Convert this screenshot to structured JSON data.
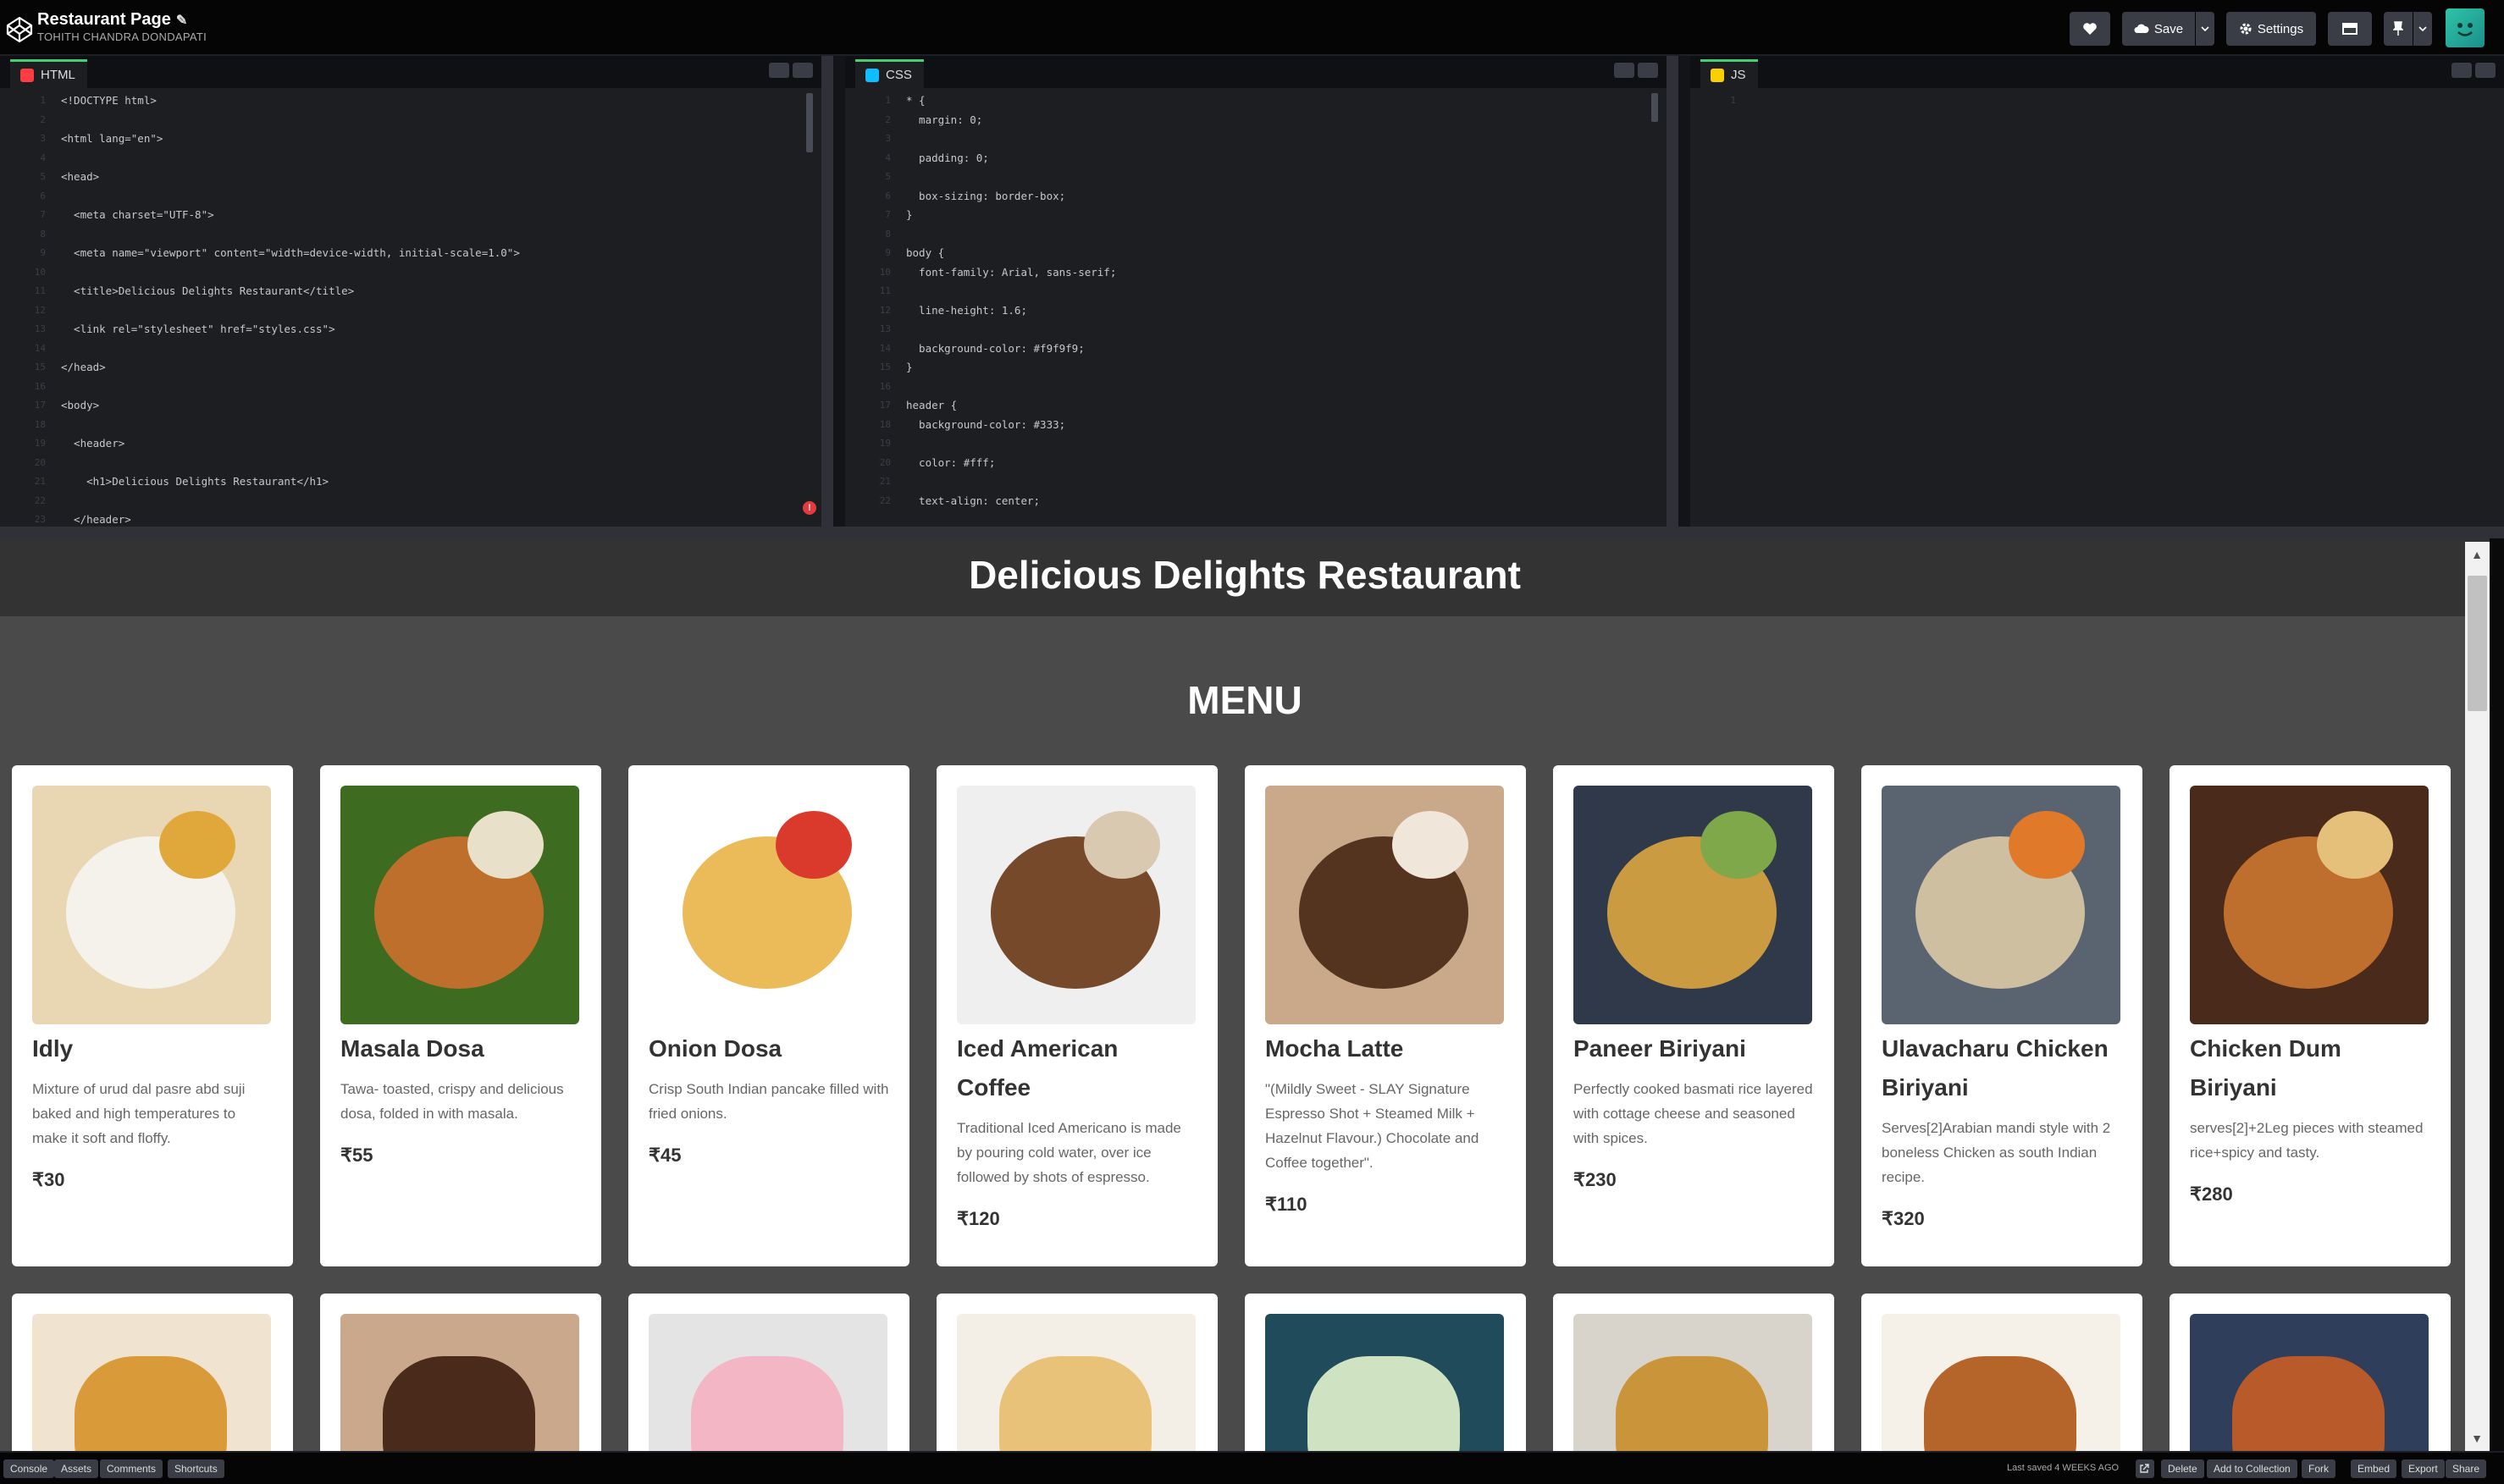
{
  "topbar": {
    "title": "Restaurant Page",
    "pencil": "✎",
    "author": "TOHITH CHANDRA DONDAPATI",
    "save_label": "Save",
    "settings_label": "Settings"
  },
  "editors": {
    "html": {
      "label": "HTML",
      "badge_color": "#ff3c41",
      "lines": [
        {
          "num": "1",
          "text": "<!DOCTYPE html>"
        },
        {
          "num": "2",
          "text": ""
        },
        {
          "num": "3",
          "text": "<html lang=\"en\">"
        },
        {
          "num": "4",
          "text": ""
        },
        {
          "num": "5",
          "text": "<head>"
        },
        {
          "num": "6",
          "text": ""
        },
        {
          "num": "7",
          "text": "  <meta charset=\"UTF-8\">"
        },
        {
          "num": "8",
          "text": ""
        },
        {
          "num": "9",
          "text": "  <meta name=\"viewport\" content=\"width=device-width, initial-scale=1.0\">"
        },
        {
          "num": "10",
          "text": ""
        },
        {
          "num": "11",
          "text": "  <title>Delicious Delights Restaurant</title>"
        },
        {
          "num": "12",
          "text": ""
        },
        {
          "num": "13",
          "text": "  <link rel=\"stylesheet\" href=\"styles.css\">"
        },
        {
          "num": "14",
          "text": ""
        },
        {
          "num": "15",
          "text": "</head>"
        },
        {
          "num": "16",
          "text": ""
        },
        {
          "num": "17",
          "text": "<body>"
        },
        {
          "num": "18",
          "text": ""
        },
        {
          "num": "19",
          "text": "  <header>"
        },
        {
          "num": "20",
          "text": ""
        },
        {
          "num": "21",
          "text": "    <h1>Delicious Delights Restaurant</h1>"
        },
        {
          "num": "22",
          "text": ""
        },
        {
          "num": "23",
          "text": "  </header>"
        }
      ],
      "error_mark": "!"
    },
    "css": {
      "label": "CSS",
      "badge_color": "#0ebeff",
      "lines": [
        {
          "num": "1",
          "text": "* {"
        },
        {
          "num": "2",
          "text": "  margin: 0;"
        },
        {
          "num": "3",
          "text": ""
        },
        {
          "num": "4",
          "text": "  padding: 0;"
        },
        {
          "num": "5",
          "text": ""
        },
        {
          "num": "6",
          "text": "  box-sizing: border-box;"
        },
        {
          "num": "7",
          "text": "}"
        },
        {
          "num": "8",
          "text": ""
        },
        {
          "num": "9",
          "text": "body {"
        },
        {
          "num": "10",
          "text": "  font-family: Arial, sans-serif;"
        },
        {
          "num": "11",
          "text": ""
        },
        {
          "num": "12",
          "text": "  line-height: 1.6;"
        },
        {
          "num": "13",
          "text": ""
        },
        {
          "num": "14",
          "text": "  background-color: #f9f9f9;"
        },
        {
          "num": "15",
          "text": "}"
        },
        {
          "num": "16",
          "text": ""
        },
        {
          "num": "17",
          "text": "header {"
        },
        {
          "num": "18",
          "text": "  background-color: #333;"
        },
        {
          "num": "19",
          "text": ""
        },
        {
          "num": "20",
          "text": "  color: #fff;"
        },
        {
          "num": "21",
          "text": ""
        },
        {
          "num": "22",
          "text": "  text-align: center;"
        }
      ]
    },
    "js": {
      "label": "JS",
      "badge_color": "#fcd000",
      "lines": [
        {
          "num": "1",
          "text": ""
        }
      ]
    }
  },
  "preview": {
    "site_title": "Delicious Delights Restaurant",
    "menu_title": "MENU",
    "items": [
      {
        "name": "Idly",
        "desc": "Mixture of urud dal pasre abd suji baked and high temperatures to make it soft and floffy.",
        "price": "₹30",
        "bg": "#e9d7b4",
        "accent": "#f4f4f0",
        "spot": "#e0a73a"
      },
      {
        "name": "Masala Dosa",
        "desc": "Tawa- toasted, crispy and delicious dosa, folded in with masala.",
        "price": "₹55",
        "bg": "#3d6b1f",
        "accent": "#c9702e",
        "spot": "#e8e0c8"
      },
      {
        "name": "Onion Dosa",
        "desc": "Crisp South Indian pancake filled with fried onions.",
        "price": "₹45",
        "bg": "#ffffff",
        "accent": "#e8b54a",
        "spot": "#d93a2b"
      },
      {
        "name": "Iced American Coffee",
        "desc": "Traditional Iced Americano is made by pouring cold water, over ice followed by shots of espresso.",
        "price": "₹120",
        "bg": "#efefef",
        "accent": "#6b3b1a",
        "spot": "#d9c9b0"
      },
      {
        "name": "Mocha Latte",
        "desc": "\"(Mildly Sweet - SLAY Signature Espresso Shot + Steamed Milk + Hazelnut Flavour.) Chocolate and Coffee together\".",
        "price": "₹110",
        "bg": "#c9a98a",
        "accent": "#4a2a16",
        "spot": "#f1e6da"
      },
      {
        "name": "Paneer Biriyani",
        "desc": "Perfectly cooked basmati rice layered with cottage cheese and seasoned with spices.",
        "price": "₹230",
        "bg": "#30394a",
        "accent": "#d9a441",
        "spot": "#7fa84a"
      },
      {
        "name": "Ulavacharu Chicken Biriyani",
        "desc": "Serves[2]Arabian mandi style with 2 boneless Chicken as south Indian recipe.",
        "price": "₹320",
        "bg": "#5a6470",
        "accent": "#d8c7a4",
        "spot": "#e07a2a"
      },
      {
        "name": "Chicken Dum Biriyani",
        "desc": "serves[2]+2Leg pieces with steamed rice+spicy and tasty.",
        "price": "₹280",
        "bg": "#4a2a1a",
        "accent": "#c8742f",
        "spot": "#e5c07a"
      }
    ],
    "row2_images": [
      {
        "bg": "#f0e4d0",
        "accent": "#d99a3a"
      },
      {
        "bg": "#c9a88c",
        "accent": "#4a2a1a"
      },
      {
        "bg": "#e4e4e4",
        "accent": "#f3b6c4"
      },
      {
        "bg": "#f4efe6",
        "accent": "#e9c27a"
      },
      {
        "bg": "#1f4b5a",
        "accent": "#cfe3c2"
      },
      {
        "bg": "#d8d4cc",
        "accent": "#c9943a"
      },
      {
        "bg": "#f5f0e8",
        "accent": "#b5652a"
      },
      {
        "bg": "#2f3e5a",
        "accent": "#b85a2a"
      }
    ]
  },
  "bottombar": {
    "left": [
      "Console",
      "Assets",
      "Comments",
      "Shortcuts"
    ],
    "saved": "Last saved 4 WEEKS AGO",
    "right": [
      "Delete",
      "Add to Collection",
      "Fork",
      "Embed",
      "Export",
      "Share"
    ]
  }
}
